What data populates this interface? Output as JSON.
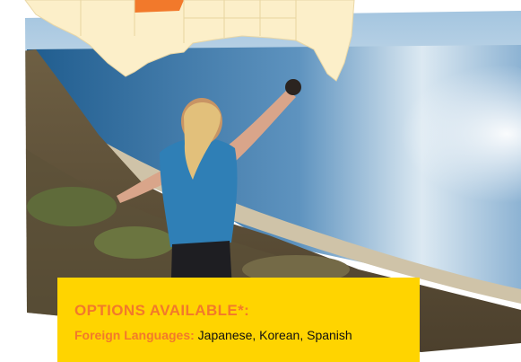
{
  "colors": {
    "box_background": "#FFD400",
    "heading": "#F2792B",
    "body_text": "#111111",
    "map_land": "#FCEFC9",
    "map_highlight": "#F2792B",
    "ocean": "#2E6FA3",
    "sky": "#BFD6E8",
    "hillside": "#7A6A4C"
  },
  "photo": {
    "icon": "hiker-on-coastal-cliff"
  },
  "map": {
    "icon": "us-gulf-coast-map"
  },
  "options": {
    "title": "OPTIONS AVAILABLE*:",
    "foreign_languages_label": "Foreign Languages:",
    "foreign_languages_value": " Japanese, Korean, Spanish"
  }
}
